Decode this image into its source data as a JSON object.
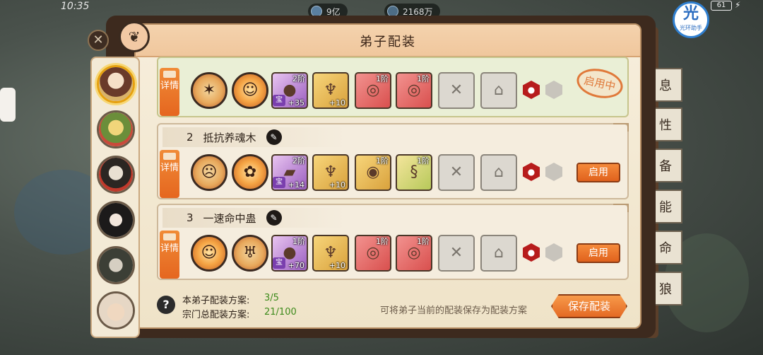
{
  "status": {
    "time": "10:35",
    "battery": "61"
  },
  "resources": [
    {
      "icon": "spirit-orb-icon",
      "value": "9亿"
    },
    {
      "icon": "jade-coin-icon",
      "value": "2168万"
    }
  ],
  "assistant": {
    "glyph": "光",
    "label": "光环助手"
  },
  "panel": {
    "title": "弟子配装"
  },
  "side_tabs": [
    "息",
    "性",
    "备",
    "能",
    "命",
    "狼"
  ],
  "loadouts": [
    {
      "index": "",
      "name": "",
      "active": true,
      "detail_label": "详情",
      "slots": [
        {
          "kind": "ring",
          "icon": "spiked-weapon-icon",
          "glyph": "✶",
          "tier": "",
          "level": ""
        },
        {
          "kind": "ring",
          "icon": "mask-icon",
          "glyph": "☺",
          "tier": "",
          "level": ""
        },
        {
          "kind": "purple",
          "icon": "pearl-icon",
          "glyph": "●",
          "tier": "2阶",
          "level": "+35",
          "treasure": "宝"
        },
        {
          "kind": "gold",
          "icon": "dragon-icon",
          "glyph": "♆",
          "tier": "",
          "level": "+10"
        },
        {
          "kind": "red",
          "icon": "swirl-icon",
          "glyph": "◎",
          "tier": "1阶",
          "level": ""
        },
        {
          "kind": "red",
          "icon": "swirl-icon",
          "glyph": "◎",
          "tier": "1阶",
          "level": ""
        },
        {
          "kind": "gray",
          "icon": "locked-scroll-icon",
          "glyph": "✕",
          "tier": "",
          "level": ""
        },
        {
          "kind": "gray",
          "icon": "lock-icon",
          "glyph": "🔒",
          "tier": "",
          "level": ""
        }
      ],
      "gems": [
        "red",
        "gray"
      ],
      "action": "启用中"
    },
    {
      "index": "2",
      "name": "抵抗养魂木",
      "active": false,
      "detail_label": "详情",
      "slots": [
        {
          "kind": "ring",
          "icon": "demon-mask-icon",
          "glyph": "☹",
          "tier": "",
          "level": ""
        },
        {
          "kind": "ring",
          "icon": "ornament-icon",
          "glyph": "✿",
          "tier": "",
          "level": ""
        },
        {
          "kind": "purple",
          "icon": "gauntlet-icon",
          "glyph": "▰",
          "tier": "2阶",
          "level": "+14",
          "treasure": "宝"
        },
        {
          "kind": "gold",
          "icon": "dragon-icon",
          "glyph": "♆",
          "tier": "",
          "level": "+10"
        },
        {
          "kind": "gold",
          "icon": "beast-icon",
          "glyph": "◉",
          "tier": "1阶",
          "level": ""
        },
        {
          "kind": "green",
          "icon": "green-dragon-icon",
          "glyph": "§",
          "tier": "1阶",
          "level": ""
        },
        {
          "kind": "gray",
          "icon": "locked-scroll-icon",
          "glyph": "✕",
          "tier": "",
          "level": ""
        },
        {
          "kind": "gray",
          "icon": "lock-icon",
          "glyph": "🔒",
          "tier": "",
          "level": ""
        }
      ],
      "gems": [
        "red",
        "gray"
      ],
      "action": "启用"
    },
    {
      "index": "3",
      "name": "一速命中蛊",
      "active": false,
      "detail_label": "详情",
      "slots": [
        {
          "kind": "ring",
          "icon": "mask-icon",
          "glyph": "☺",
          "tier": "",
          "level": ""
        },
        {
          "kind": "ring",
          "icon": "totem-icon",
          "glyph": "♅",
          "tier": "",
          "level": ""
        },
        {
          "kind": "purple",
          "icon": "pearl-icon",
          "glyph": "●",
          "tier": "1阶",
          "level": "+70",
          "treasure": "宝"
        },
        {
          "kind": "gold",
          "icon": "dragon-icon",
          "glyph": "♆",
          "tier": "",
          "level": "+10"
        },
        {
          "kind": "red",
          "icon": "swirl-icon",
          "glyph": "◎",
          "tier": "1阶",
          "level": ""
        },
        {
          "kind": "red",
          "icon": "swirl-icon",
          "glyph": "◎",
          "tier": "1阶",
          "level": ""
        },
        {
          "kind": "gray",
          "icon": "locked-scroll-icon",
          "glyph": "✕",
          "tier": "",
          "level": ""
        },
        {
          "kind": "gray",
          "icon": "lock-icon",
          "glyph": "🔒",
          "tier": "",
          "level": ""
        }
      ],
      "gems": [
        "red",
        "gray"
      ],
      "action": "启用"
    }
  ],
  "footer": {
    "disciple_label": "本弟子配装方案:",
    "disciple_value": "3/5",
    "sect_label": "宗门总配装方案:",
    "sect_value": "21/100",
    "hint": "可将弟子当前的配装保存为配装方案",
    "save_label": "保存配装"
  },
  "colors": {
    "accent": "#e46a24",
    "count_green": "#3c8a1a",
    "panel_bg": "#f7eedc"
  }
}
